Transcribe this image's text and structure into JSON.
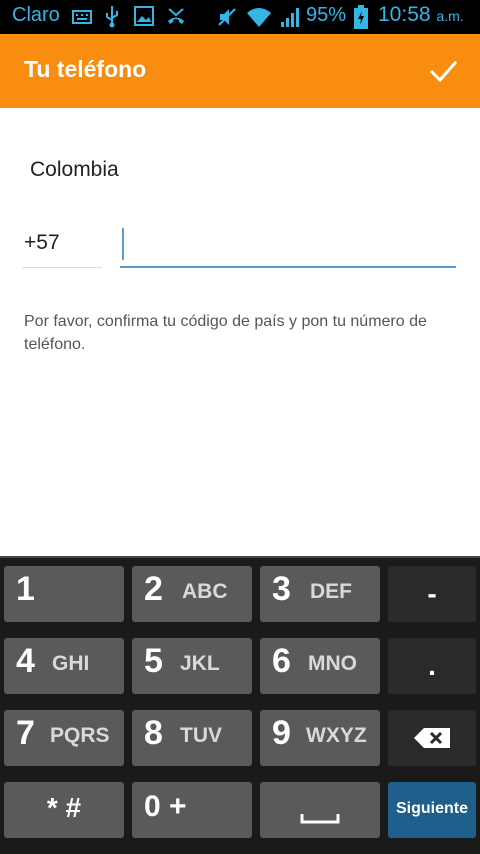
{
  "status_bar": {
    "carrier": "Claro",
    "battery": "95%",
    "time": "10:58",
    "ampm": "a.m."
  },
  "header": {
    "title": "Tu teléfono",
    "done_icon": "check-icon"
  },
  "form": {
    "country": "Colombia",
    "country_code": "+57",
    "phone_value": "",
    "phone_placeholder": "",
    "hint": "Por favor, confirma tu código de país y pon tu número de teléfono."
  },
  "keyboard": {
    "k1": {
      "digit": "1",
      "letters": ""
    },
    "k2": {
      "digit": "2",
      "letters": "ABC"
    },
    "k3": {
      "digit": "3",
      "letters": "DEF"
    },
    "k4": {
      "digit": "4",
      "letters": "GHI"
    },
    "k5": {
      "digit": "5",
      "letters": "JKL"
    },
    "k6": {
      "digit": "6",
      "letters": "MNO"
    },
    "k7": {
      "digit": "7",
      "letters": "PQRS"
    },
    "k8": {
      "digit": "8",
      "letters": "TUV"
    },
    "k9": {
      "digit": "9",
      "letters": "WXYZ"
    },
    "star": "* #",
    "zero": "0 +",
    "minus": "-",
    "dot": ".",
    "next": "Siguiente"
  },
  "colors": {
    "accent": "#f98d0f",
    "status_icons": "#33b5e5",
    "underline": "#5b9bd5"
  }
}
